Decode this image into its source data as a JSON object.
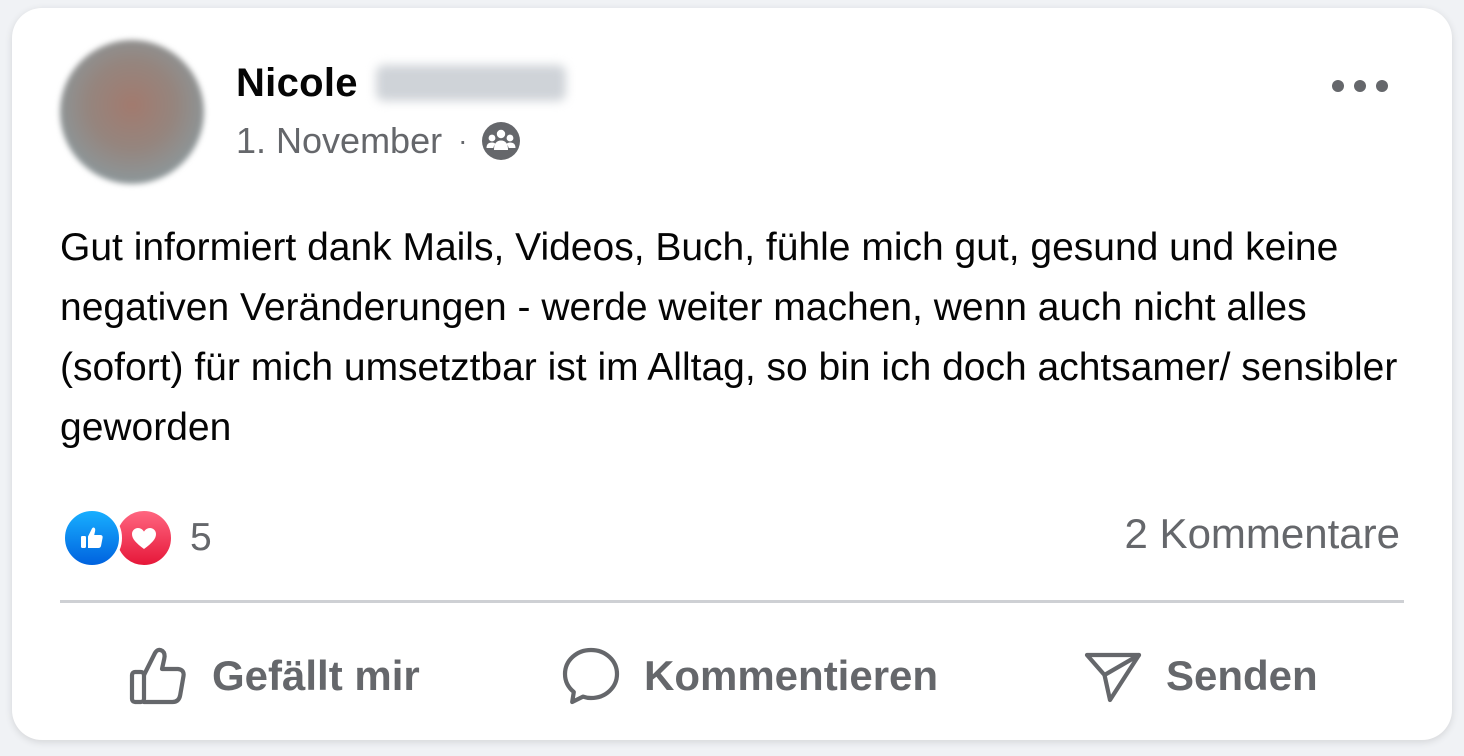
{
  "post": {
    "author_name": "Nicole",
    "date": "1. November",
    "separator": "·",
    "audience_icon": "friends-icon",
    "text": "Gut informiert dank Mails, Videos, Buch, fühle mich gut, gesund und keine negativen Veränderungen - werde weiter machen, wenn auch nicht alles (sofort) für mich umsetztbar ist im Alltag, so bin ich doch achtsamer/ sensibler geworden"
  },
  "reactions": {
    "types": [
      "like-icon",
      "love-icon"
    ],
    "count": "5",
    "comments_label": "2 Kommentare"
  },
  "actions": {
    "like_label": "Gefällt mir",
    "comment_label": "Kommentieren",
    "send_label": "Senden"
  },
  "colors": {
    "like_blue": "#0866ff",
    "love_red": "#f33e58",
    "secondary_text": "#65676b",
    "primary_text": "#050505"
  }
}
